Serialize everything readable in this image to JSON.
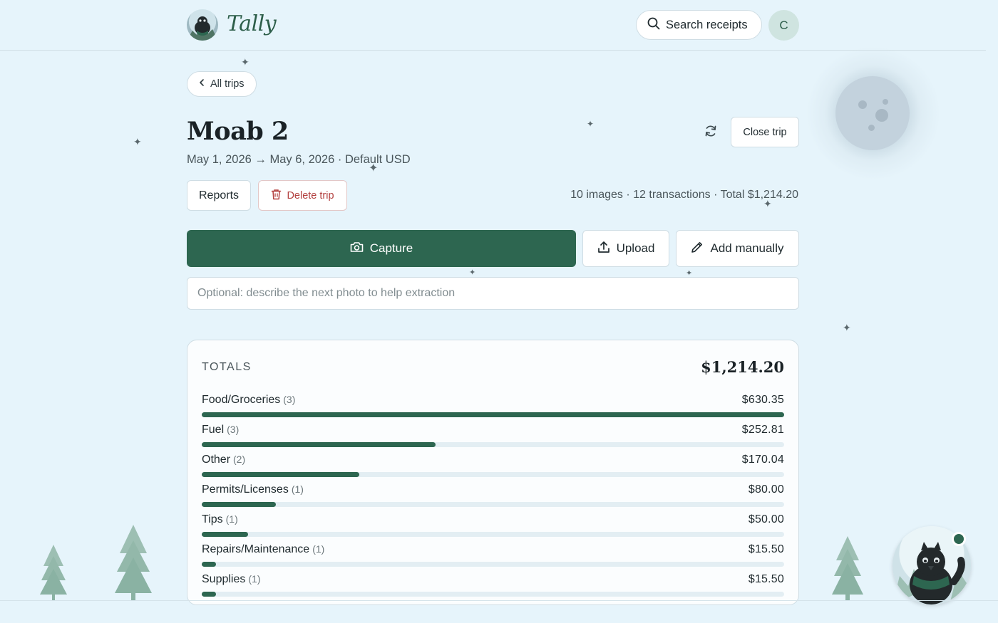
{
  "header": {
    "brand": "Tally",
    "search_label": "Search receipts",
    "user_initial": "C"
  },
  "nav": {
    "back_label": "All trips"
  },
  "trip": {
    "title": "Moab 2",
    "meta": "May 1, 2026 → May 6, 2026 · Default USD",
    "close_label": "Close trip",
    "reports_label": "Reports",
    "delete_label": "Delete trip",
    "summary": "10 images · 12 transactions · Total $1,214.20"
  },
  "actions": {
    "capture_label": "Capture",
    "upload_label": "Upload",
    "manual_label": "Add manually",
    "hint_placeholder": "Optional: describe the next photo to help extraction"
  },
  "totals": {
    "label": "TOTALS",
    "amount": "$1,214.20",
    "categories": [
      {
        "name": "Food/Groceries",
        "count": "(3)",
        "value": "$630.35",
        "fraction": 1.0
      },
      {
        "name": "Fuel",
        "count": "(3)",
        "value": "$252.81",
        "fraction": 0.401
      },
      {
        "name": "Other",
        "count": "(2)",
        "value": "$170.04",
        "fraction": 0.27
      },
      {
        "name": "Permits/Licenses",
        "count": "(1)",
        "value": "$80.00",
        "fraction": 0.127
      },
      {
        "name": "Tips",
        "count": "(1)",
        "value": "$50.00",
        "fraction": 0.079
      },
      {
        "name": "Repairs/Maintenance",
        "count": "(1)",
        "value": "$15.50",
        "fraction": 0.025
      },
      {
        "name": "Supplies",
        "count": "(1)",
        "value": "$15.50",
        "fraction": 0.025
      }
    ]
  },
  "colors": {
    "accent": "#2d6650",
    "background": "#e6f4fb",
    "danger": "#b3403f"
  },
  "icons": [
    "search-icon",
    "chevron-left-icon",
    "refresh-icon",
    "trash-icon",
    "camera-icon",
    "upload-icon",
    "pencil-icon"
  ]
}
